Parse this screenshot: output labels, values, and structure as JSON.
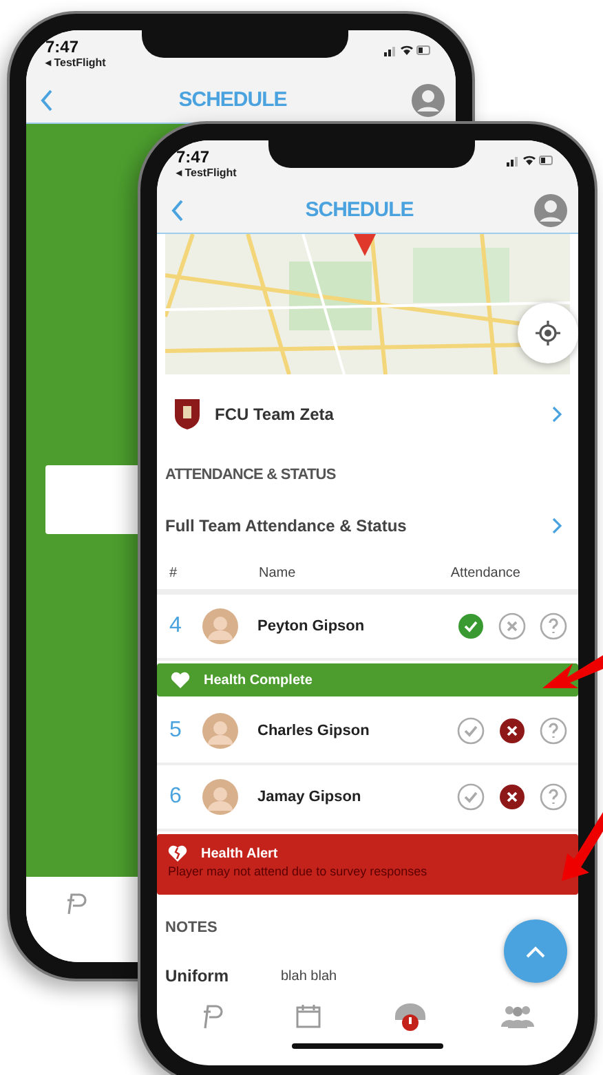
{
  "back_phone": {
    "status_bar": {
      "time": "7:47",
      "back_app": "◂ TestFlight"
    },
    "nav": {
      "title": "SCHEDULE"
    }
  },
  "front_phone": {
    "status_bar": {
      "time": "7:47",
      "back_app": "◂ TestFlight"
    },
    "nav": {
      "title": "SCHEDULE"
    },
    "team": {
      "name": "FCU Team Zeta"
    },
    "attendance_section": {
      "heading": "ATTENDANCE & STATUS",
      "link": "Full Team Attendance & Status",
      "columns": [
        "#",
        "Name",
        "Attendance"
      ],
      "players": [
        {
          "number": "4",
          "name": "Peyton Gipson",
          "choices": [
            {
              "kind": "yes",
              "selected": true
            },
            {
              "kind": "no",
              "selected": false
            },
            {
              "kind": "maybe",
              "selected": false
            }
          ],
          "health": {
            "kind": "complete",
            "title": "Health Complete"
          }
        },
        {
          "number": "5",
          "name": "Charles Gipson",
          "choices": [
            {
              "kind": "yes",
              "selected": false
            },
            {
              "kind": "no",
              "selected": true
            },
            {
              "kind": "maybe",
              "selected": false
            }
          ]
        },
        {
          "number": "6",
          "name": "Jamay Gipson",
          "choices": [
            {
              "kind": "yes",
              "selected": false
            },
            {
              "kind": "no",
              "selected": true
            },
            {
              "kind": "maybe",
              "selected": false
            }
          ],
          "health": {
            "kind": "alert",
            "title": "Health Alert",
            "message": "Player may not attend due to survey responses"
          }
        }
      ]
    },
    "notes": {
      "heading": "NOTES",
      "items": [
        {
          "label": "Uniform",
          "value": "blah blah"
        }
      ]
    }
  }
}
